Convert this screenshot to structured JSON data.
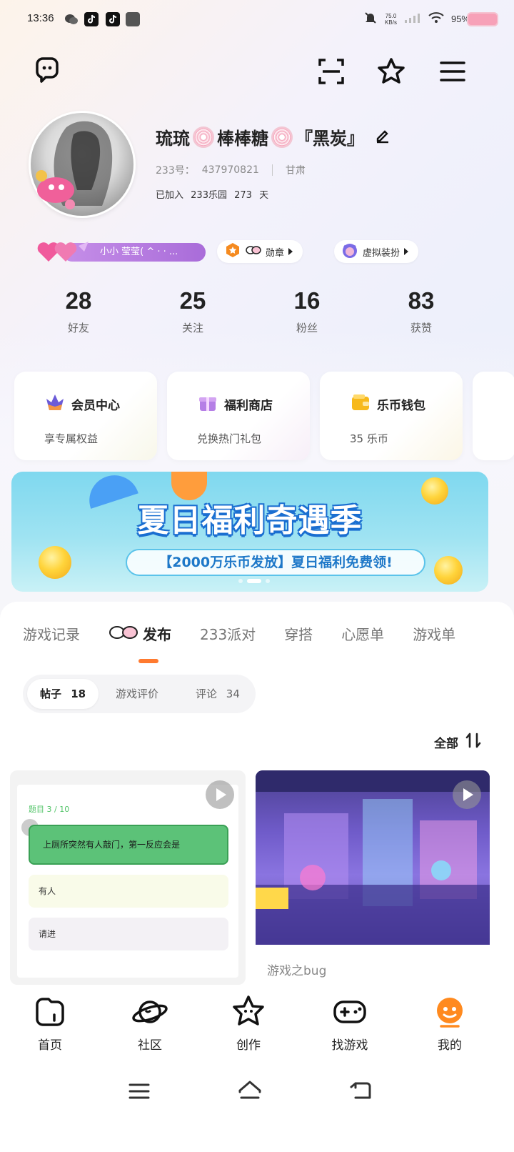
{
  "status_bar": {
    "time": "13:36",
    "net_speed": "75.0",
    "net_unit": "KB/s",
    "battery": "95%"
  },
  "profile": {
    "name_part1": "琉琉",
    "name_part2": "棒棒糖",
    "name_part3": "『黑炭』",
    "uid_label": "233号：",
    "uid": "437970821",
    "region": "甘肃",
    "joined_prefix": "已加入",
    "joined_place": "233乐园",
    "joined_days": "273",
    "joined_unit": "天"
  },
  "badges": {
    "level_text": "小小  莹莹( ^ · · ...",
    "medal_label": "勋章",
    "dressup_label": "虚拟装扮"
  },
  "stats": [
    {
      "value": "28",
      "label": "好友"
    },
    {
      "value": "25",
      "label": "关注"
    },
    {
      "value": "16",
      "label": "粉丝"
    },
    {
      "value": "83",
      "label": "获赞"
    }
  ],
  "cards": [
    {
      "title": "会员中心",
      "sub": "享专属权益"
    },
    {
      "title": "福利商店",
      "sub": "兑换热门礼包"
    },
    {
      "title": "乐币钱包",
      "sub": "35  乐币"
    }
  ],
  "banner": {
    "title": "夏日福利奇遇季",
    "subtitle": "【2000万乐币发放】夏日福利免费领!"
  },
  "tabs": [
    "游戏记录",
    "发布",
    "233派对",
    "穿搭",
    "心愿单",
    "游戏单"
  ],
  "subtabs": [
    {
      "label": "帖子",
      "count": "18"
    },
    {
      "label": "游戏评价",
      "count": ""
    },
    {
      "label": "评论",
      "count": "34"
    }
  ],
  "sort_label": "全部",
  "posts": {
    "quiz_num": "题目 3 / 10",
    "quiz_q": "上厕所突然有人敲门，第一反应会是",
    "answer1": "有人",
    "answer2": "请进",
    "post2_title": "游戏之bug"
  },
  "bottom_nav": [
    {
      "label": "首页"
    },
    {
      "label": "社区"
    },
    {
      "label": "创作"
    },
    {
      "label": "找游戏"
    },
    {
      "label": "我的"
    }
  ],
  "colors": {
    "accent": "#ff7a2f",
    "level_purple": "#a96cd9",
    "banner_blue": "#1b6fd1"
  }
}
